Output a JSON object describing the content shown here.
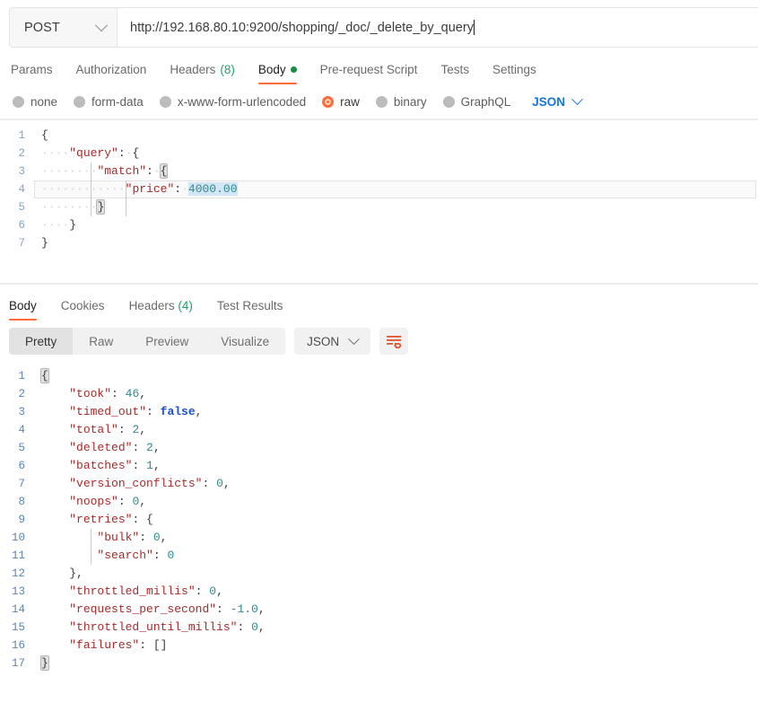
{
  "request": {
    "method": "POST",
    "method_dropdown_icon": "chevron-down-icon",
    "url": "http://192.168.80.10:9200/shopping/_doc/_delete_by_query",
    "tabs": [
      {
        "label": "Params",
        "active": false
      },
      {
        "label": "Authorization",
        "active": false
      },
      {
        "label": "Headers",
        "count": "(8)",
        "active": false
      },
      {
        "label": "Body",
        "active": true,
        "indicator": "green-dot"
      },
      {
        "label": "Pre-request Script",
        "active": false
      },
      {
        "label": "Tests",
        "active": false
      },
      {
        "label": "Settings",
        "active": false
      }
    ],
    "body_types": [
      {
        "label": "none",
        "selected": false
      },
      {
        "label": "form-data",
        "selected": false
      },
      {
        "label": "x-www-form-urlencoded",
        "selected": false
      },
      {
        "label": "raw",
        "selected": true
      },
      {
        "label": "binary",
        "selected": false
      },
      {
        "label": "GraphQL",
        "selected": false
      }
    ],
    "raw_format": "JSON",
    "raw_format_icon": "chevron-down-icon",
    "body_lines": [
      {
        "n": "1",
        "segments": [
          {
            "t": "{",
            "c": "brk"
          }
        ]
      },
      {
        "n": "2",
        "segments": [
          {
            "t": "····",
            "c": "dots"
          },
          {
            "t": "\"query\"",
            "c": "k"
          },
          {
            "t": ":",
            "c": "pun"
          },
          {
            "t": "·",
            "c": "dots"
          },
          {
            "t": "{",
            "c": "brk"
          }
        ]
      },
      {
        "n": "3",
        "segments": [
          {
            "t": "····",
            "c": "dots"
          },
          {
            "t": "····",
            "c": "dots"
          },
          {
            "t": "\"match\"",
            "c": "k"
          },
          {
            "t": ":",
            "c": "pun"
          },
          {
            "t": "·",
            "c": "dots"
          },
          {
            "t": "{",
            "c": "bracket-hl brk"
          }
        ]
      },
      {
        "n": "4",
        "active": true,
        "segments": [
          {
            "t": "····",
            "c": "dots"
          },
          {
            "t": "····",
            "c": "dots"
          },
          {
            "t": "····",
            "c": "dots"
          },
          {
            "t": "\"price\"",
            "c": "k"
          },
          {
            "t": ":",
            "c": "pun"
          },
          {
            "t": "·",
            "c": "dots"
          },
          {
            "t": "4000.00",
            "c": "num sel-hl"
          }
        ]
      },
      {
        "n": "5",
        "segments": [
          {
            "t": "····",
            "c": "dots"
          },
          {
            "t": "····",
            "c": "dots"
          },
          {
            "t": "}",
            "c": "bracket-hl brk"
          }
        ]
      },
      {
        "n": "6",
        "segments": [
          {
            "t": "····",
            "c": "dots"
          },
          {
            "t": "}",
            "c": "brk"
          }
        ]
      },
      {
        "n": "7",
        "segments": [
          {
            "t": "}",
            "c": "brk"
          }
        ]
      }
    ]
  },
  "response": {
    "tabs": [
      {
        "label": "Body",
        "active": true
      },
      {
        "label": "Cookies",
        "active": false
      },
      {
        "label": "Headers",
        "count": "(4)",
        "active": false
      },
      {
        "label": "Test Results",
        "active": false
      }
    ],
    "view_modes": [
      {
        "label": "Pretty",
        "active": true
      },
      {
        "label": "Raw",
        "active": false
      },
      {
        "label": "Preview",
        "active": false
      },
      {
        "label": "Visualize",
        "active": false
      }
    ],
    "format": "JSON",
    "format_icon": "chevron-down-icon",
    "wrap_icon": "wrap-lines-icon",
    "body_lines": [
      {
        "n": "1",
        "segments": [
          {
            "t": "{",
            "c": "bracket-hl brk"
          }
        ]
      },
      {
        "n": "2",
        "segments": [
          {
            "t": "    ",
            "c": "pun"
          },
          {
            "t": "\"took\"",
            "c": "k"
          },
          {
            "t": ": ",
            "c": "pun"
          },
          {
            "t": "46",
            "c": "num"
          },
          {
            "t": ",",
            "c": "pun"
          }
        ]
      },
      {
        "n": "3",
        "segments": [
          {
            "t": "    ",
            "c": "pun"
          },
          {
            "t": "\"timed_out\"",
            "c": "k"
          },
          {
            "t": ": ",
            "c": "pun"
          },
          {
            "t": "false",
            "c": "bool"
          },
          {
            "t": ",",
            "c": "pun"
          }
        ]
      },
      {
        "n": "4",
        "segments": [
          {
            "t": "    ",
            "c": "pun"
          },
          {
            "t": "\"total\"",
            "c": "k"
          },
          {
            "t": ": ",
            "c": "pun"
          },
          {
            "t": "2",
            "c": "num"
          },
          {
            "t": ",",
            "c": "pun"
          }
        ]
      },
      {
        "n": "5",
        "segments": [
          {
            "t": "    ",
            "c": "pun"
          },
          {
            "t": "\"deleted\"",
            "c": "k"
          },
          {
            "t": ": ",
            "c": "pun"
          },
          {
            "t": "2",
            "c": "num"
          },
          {
            "t": ",",
            "c": "pun"
          }
        ]
      },
      {
        "n": "6",
        "segments": [
          {
            "t": "    ",
            "c": "pun"
          },
          {
            "t": "\"batches\"",
            "c": "k"
          },
          {
            "t": ": ",
            "c": "pun"
          },
          {
            "t": "1",
            "c": "num"
          },
          {
            "t": ",",
            "c": "pun"
          }
        ]
      },
      {
        "n": "7",
        "segments": [
          {
            "t": "    ",
            "c": "pun"
          },
          {
            "t": "\"version_conflicts\"",
            "c": "k"
          },
          {
            "t": ": ",
            "c": "pun"
          },
          {
            "t": "0",
            "c": "num"
          },
          {
            "t": ",",
            "c": "pun"
          }
        ]
      },
      {
        "n": "8",
        "segments": [
          {
            "t": "    ",
            "c": "pun"
          },
          {
            "t": "\"noops\"",
            "c": "k"
          },
          {
            "t": ": ",
            "c": "pun"
          },
          {
            "t": "0",
            "c": "num"
          },
          {
            "t": ",",
            "c": "pun"
          }
        ]
      },
      {
        "n": "9",
        "segments": [
          {
            "t": "    ",
            "c": "pun"
          },
          {
            "t": "\"retries\"",
            "c": "k"
          },
          {
            "t": ": ",
            "c": "pun"
          },
          {
            "t": "{",
            "c": "brk"
          }
        ]
      },
      {
        "n": "10",
        "segments": [
          {
            "t": "        ",
            "c": "pun"
          },
          {
            "t": "\"bulk\"",
            "c": "k"
          },
          {
            "t": ": ",
            "c": "pun"
          },
          {
            "t": "0",
            "c": "num"
          },
          {
            "t": ",",
            "c": "pun"
          }
        ]
      },
      {
        "n": "11",
        "segments": [
          {
            "t": "        ",
            "c": "pun"
          },
          {
            "t": "\"search\"",
            "c": "k"
          },
          {
            "t": ": ",
            "c": "pun"
          },
          {
            "t": "0",
            "c": "num"
          }
        ]
      },
      {
        "n": "12",
        "segments": [
          {
            "t": "    ",
            "c": "pun"
          },
          {
            "t": "},",
            "c": "brk"
          }
        ]
      },
      {
        "n": "13",
        "segments": [
          {
            "t": "    ",
            "c": "pun"
          },
          {
            "t": "\"throttled_millis\"",
            "c": "k"
          },
          {
            "t": ": ",
            "c": "pun"
          },
          {
            "t": "0",
            "c": "num"
          },
          {
            "t": ",",
            "c": "pun"
          }
        ]
      },
      {
        "n": "14",
        "segments": [
          {
            "t": "    ",
            "c": "pun"
          },
          {
            "t": "\"requests_per_second\"",
            "c": "k"
          },
          {
            "t": ": ",
            "c": "pun"
          },
          {
            "t": "-1.0",
            "c": "num"
          },
          {
            "t": ",",
            "c": "pun"
          }
        ]
      },
      {
        "n": "15",
        "segments": [
          {
            "t": "    ",
            "c": "pun"
          },
          {
            "t": "\"throttled_until_millis\"",
            "c": "k"
          },
          {
            "t": ": ",
            "c": "pun"
          },
          {
            "t": "0",
            "c": "num"
          },
          {
            "t": ",",
            "c": "pun"
          }
        ]
      },
      {
        "n": "16",
        "segments": [
          {
            "t": "    ",
            "c": "pun"
          },
          {
            "t": "\"failures\"",
            "c": "k"
          },
          {
            "t": ": ",
            "c": "pun"
          },
          {
            "t": "[]",
            "c": "brk"
          }
        ]
      },
      {
        "n": "17",
        "segments": [
          {
            "t": "}",
            "c": "bracket-hl brk"
          }
        ]
      }
    ]
  },
  "colors": {
    "accent_orange": "#ff6c37",
    "link_blue": "#1576d6",
    "count_green": "#22a06b",
    "json_key": "#a52b2b",
    "json_number": "#2e8b8b",
    "json_bool": "#1a4fd6"
  }
}
